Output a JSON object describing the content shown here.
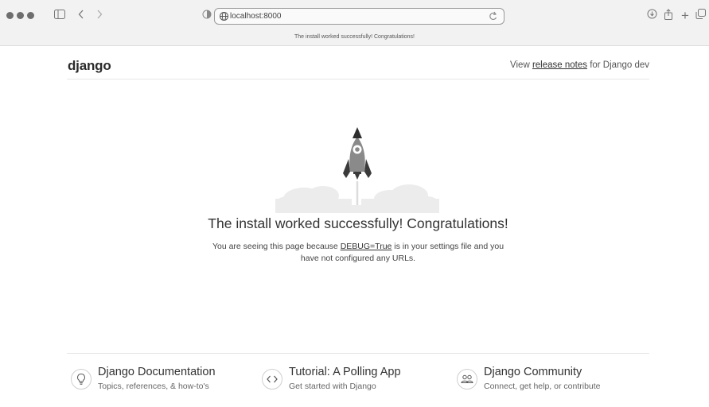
{
  "browser": {
    "url": "localhost:8000",
    "tab_title": "The install worked successfully! Congratulations!"
  },
  "header": {
    "logo": "django",
    "release_prefix": "View ",
    "release_link": "release notes",
    "release_suffix": " for Django dev"
  },
  "main": {
    "title": "The install worked successfully! Congratulations!",
    "desc_before": "You are seeing this page because ",
    "desc_link": "DEBUG=True",
    "desc_after": " is in your settings file and you have not configured any URLs."
  },
  "footer": {
    "cards": [
      {
        "title": "Django Documentation",
        "subtitle": "Topics, references, & how-to's",
        "icon": "lightbulb-icon"
      },
      {
        "title": "Tutorial: A Polling App",
        "subtitle": "Get started with Django",
        "icon": "code-icon"
      },
      {
        "title": "Django Community",
        "subtitle": "Connect, get help, or contribute",
        "icon": "people-icon"
      }
    ]
  }
}
